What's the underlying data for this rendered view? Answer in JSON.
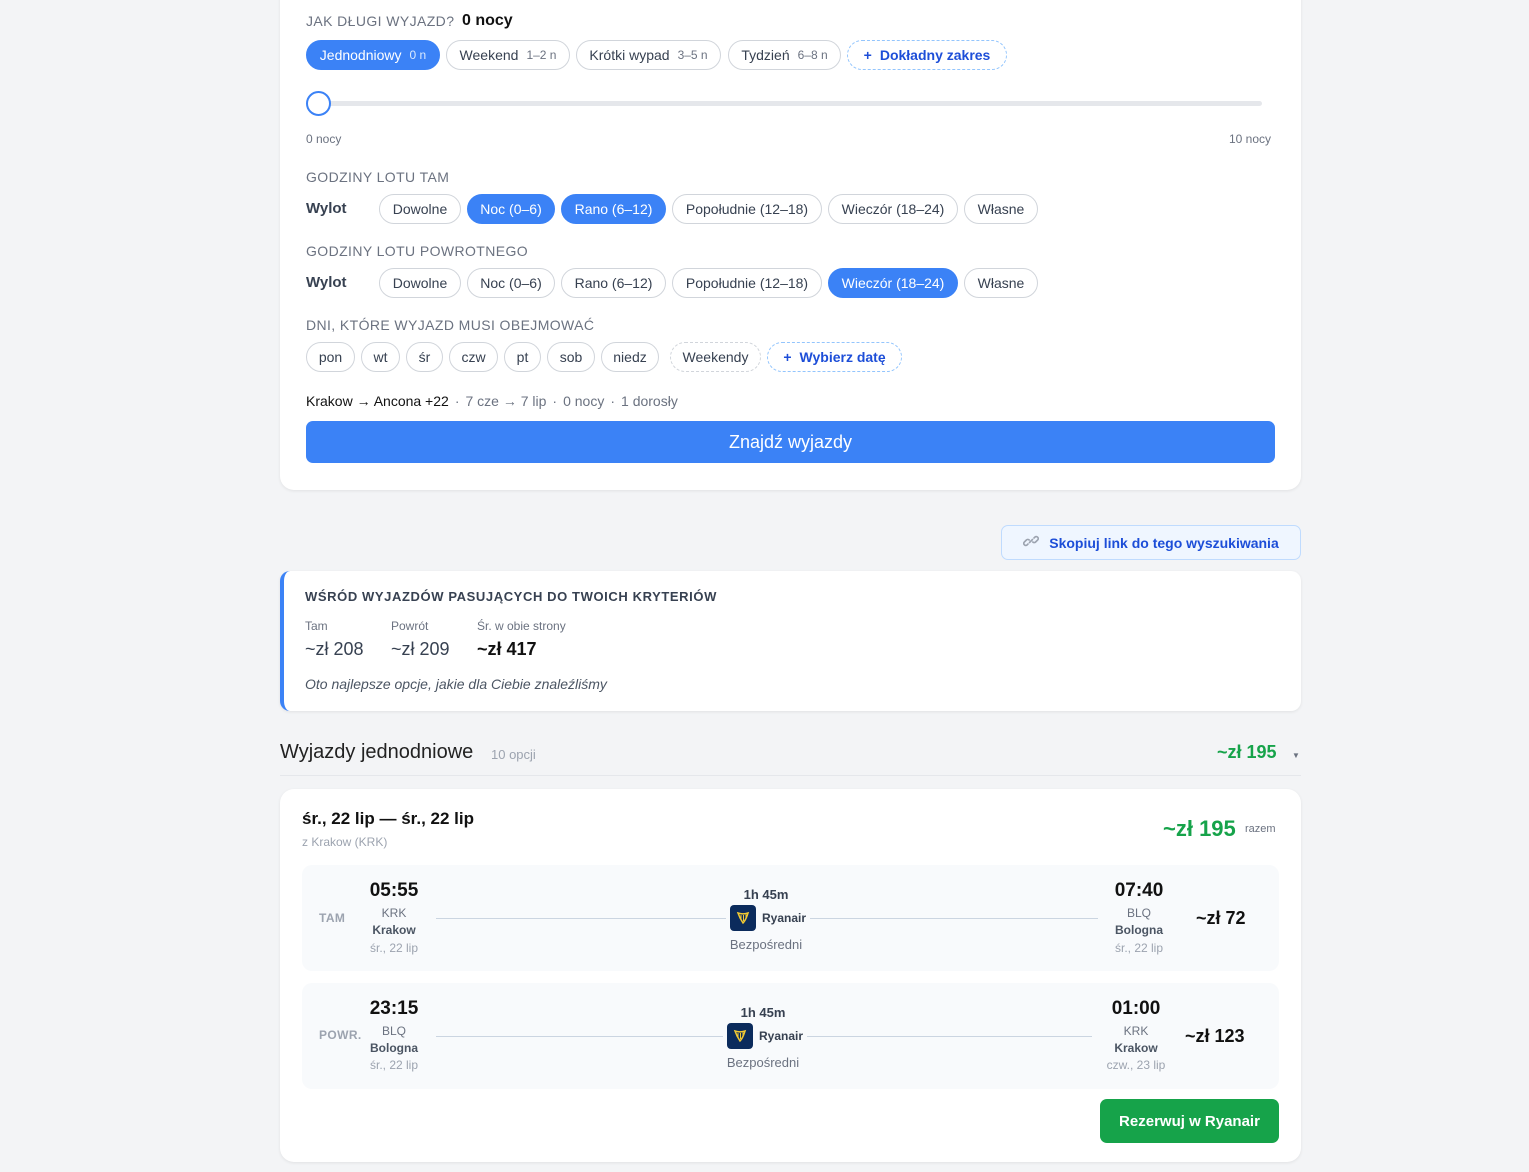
{
  "duration": {
    "label": "JAK DŁUGI WYJAZD?",
    "value": "0 nocy",
    "presets": [
      {
        "label": "Jednodniowy",
        "sub": "0 n"
      },
      {
        "label": "Weekend",
        "sub": "1–2 n"
      },
      {
        "label": "Krótki wypad",
        "sub": "3–5 n"
      },
      {
        "label": "Tydzień",
        "sub": "6–8 n"
      }
    ],
    "exact_range": "Dokładny zakres",
    "slider": {
      "min_label": "0 nocy",
      "max_label": "10 nocy",
      "value": 0,
      "min": 0,
      "max": 10
    }
  },
  "outbound_hours": {
    "label": "GODZINY LOTU TAM",
    "row_label": "Wylot",
    "options": [
      "Dowolne",
      "Noc (0–6)",
      "Rano (6–12)",
      "Popołudnie (12–18)",
      "Wieczór (18–24)",
      "Własne"
    ]
  },
  "return_hours": {
    "label": "GODZINY LOTU POWROTNEGO",
    "row_label": "Wylot",
    "options": [
      "Dowolne",
      "Noc (0–6)",
      "Rano (6–12)",
      "Popołudnie (12–18)",
      "Wieczór (18–24)",
      "Własne"
    ]
  },
  "days": {
    "label": "DNI, KTÓRE WYJAZD MUSI OBEJMOWAĆ",
    "options": [
      "pon",
      "wt",
      "śr",
      "czw",
      "pt",
      "sob",
      "niedz"
    ],
    "weekends": "Weekendy",
    "pick_date": "Wybierz datę"
  },
  "summary": {
    "route": "Krakow → Ancona +22",
    "dates": "7 cze → 7 lip",
    "nights": "0 nocy",
    "pax": "1 dorosły"
  },
  "find_button": "Znajdź wyjazdy",
  "copy_link": "Skopiuj link do tego wyszukiwania",
  "stats": {
    "title": "WŚRÓD WYJAZDÓW PASUJĄCYCH DO TWOICH KRYTERIÓW",
    "outbound_label": "Tam",
    "outbound_value": "~zł 208",
    "return_label": "Powrót",
    "return_value": "~zł 209",
    "avg_label": "Śr. w obie strony",
    "avg_value": "~zł 417",
    "note": "Oto najlepsze opcje, jakie dla Ciebie znaleźliśmy"
  },
  "group": {
    "title": "Wyjazdy jednodniowe",
    "count": "10 opcji",
    "price": "~zł 195",
    "caret": "▼"
  },
  "trip": {
    "dates": "śr., 22 lip — śr., 22 lip",
    "from": "z Krakow (KRK)",
    "price": "~zł 195",
    "price_suffix": "razem",
    "legs": [
      {
        "dir": "TAM",
        "dep_time": "05:55",
        "dep_code": "KRK",
        "dep_city": "Krakow",
        "dep_date": "śr., 22 lip",
        "duration": "1h 45m",
        "airline": "Ryanair",
        "stops": "Bezpośredni",
        "arr_time": "07:40",
        "arr_code": "BLQ",
        "arr_city": "Bologna",
        "arr_date": "śr., 22 lip",
        "price": "~zł 72"
      },
      {
        "dir": "POWR.",
        "dep_time": "23:15",
        "dep_code": "BLQ",
        "dep_city": "Bologna",
        "dep_date": "śr., 22 lip",
        "duration": "1h 45m",
        "airline": "Ryanair",
        "stops": "Bezpośredni",
        "arr_time": "01:00",
        "arr_code": "KRK",
        "arr_city": "Krakow",
        "arr_date": "czw., 23 lip",
        "price": "~zł 123"
      }
    ],
    "book_button": "Rezerwuj w Ryanair"
  },
  "colors": {
    "accent": "#3b82f6",
    "price_green": "#16a34a",
    "airline_logo": "#0b2b5c",
    "harp_gold": "#f1c933"
  },
  "icons": {
    "plus": "plus-icon",
    "link": "link-icon",
    "airline": "ryanair-harp-icon",
    "caret": "chevron-down-icon"
  }
}
